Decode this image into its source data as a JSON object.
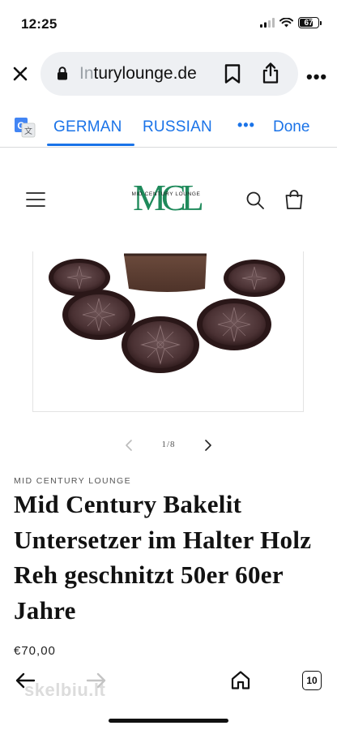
{
  "status_bar": {
    "time": "12:25",
    "battery_level": "67",
    "battery_fraction": 0.67
  },
  "browser": {
    "url_faded": "Ιn",
    "url_text": "turylounge.de",
    "close_icon": "close-icon",
    "lock_icon": "lock-icon",
    "bookmark_icon": "bookmark-icon",
    "share_icon": "share-icon",
    "more_label": "•••"
  },
  "translate_bar": {
    "active_language": "GERMAN",
    "other_language": "RUSSIAN",
    "more_label": "•••",
    "done_label": "Done",
    "accent_color": "#1a73e8"
  },
  "site_header": {
    "logo_monogram": "MCL",
    "logo_tagline": "MID CENTURY LOUNGE",
    "logo_color": "#1f8a5b"
  },
  "gallery": {
    "position": "1/8"
  },
  "product": {
    "vendor": "MID CENTURY LOUNGE",
    "title": "Mid Century Bakelit Untersetzer im Halter Holz Reh geschnitzt 50er 60er Jahre",
    "price": "€70,00"
  },
  "toolbar": {
    "tab_count": "10",
    "watermark": "skelbiu.lt"
  }
}
